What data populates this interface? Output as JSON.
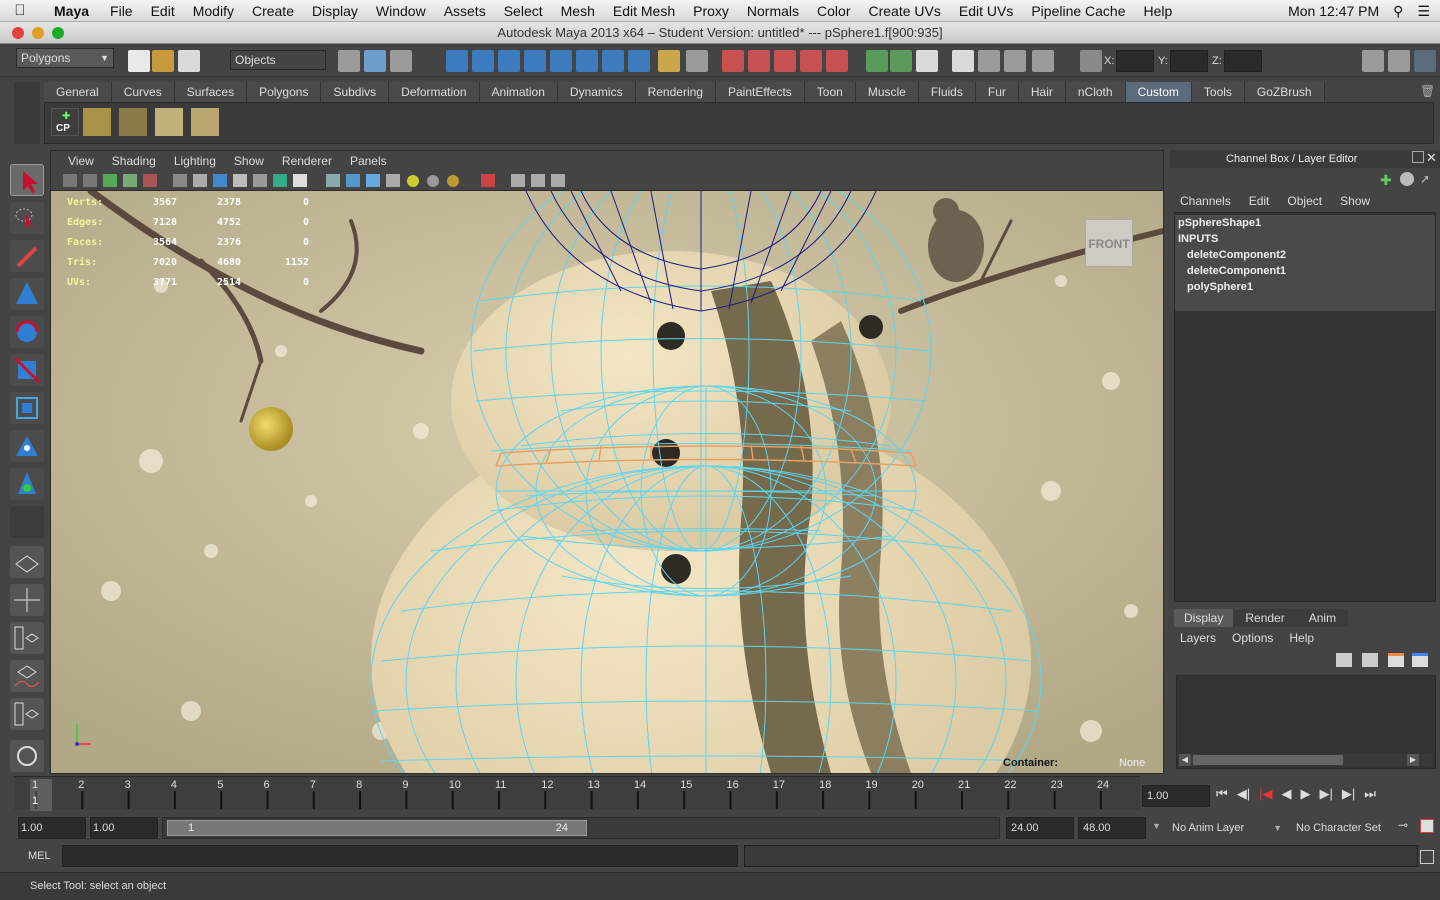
{
  "menubar": {
    "app": "Maya",
    "items": [
      "File",
      "Edit",
      "Modify",
      "Create",
      "Display",
      "Window",
      "Assets",
      "Select",
      "Mesh",
      "Edit Mesh",
      "Proxy",
      "Normals",
      "Color",
      "Create UVs",
      "Edit UVs",
      "Pipeline Cache",
      "Help"
    ],
    "clock": "Mon 12:47 PM"
  },
  "window": {
    "title": "Autodesk Maya 2013 x64 – Student Version: untitled*   ---   pSphere1.f[900:935]"
  },
  "statusline": {
    "menuset": "Polygons",
    "selection_mask": "Objects",
    "x_label": "X:",
    "y_label": "Y:",
    "z_label": "Z:"
  },
  "shelf": {
    "tabs": [
      "General",
      "Curves",
      "Surfaces",
      "Polygons",
      "Subdivs",
      "Deformation",
      "Animation",
      "Dynamics",
      "Rendering",
      "PaintEffects",
      "Toon",
      "Muscle",
      "Fluids",
      "Fur",
      "Hair",
      "nCloth",
      "Custom",
      "Tools",
      "GoZBrush"
    ],
    "active_tab": "Custom",
    "cp_label": "CP"
  },
  "viewport": {
    "menus": [
      "View",
      "Shading",
      "Lighting",
      "Show",
      "Renderer",
      "Panels"
    ],
    "hud": {
      "rows": [
        {
          "label": "Verts:",
          "a": "3567",
          "b": "2378",
          "c": "0"
        },
        {
          "label": "Edges:",
          "a": "7128",
          "b": "4752",
          "c": "0"
        },
        {
          "label": "Faces:",
          "a": "3564",
          "b": "2376",
          "c": "0"
        },
        {
          "label": "Tris:",
          "a": "7020",
          "b": "4680",
          "c": "1152"
        },
        {
          "label": "UVs:",
          "a": "3771",
          "b": "2514",
          "c": "0"
        }
      ],
      "view_cube": "FRONT",
      "container_label": "Container:",
      "container_value": "None"
    }
  },
  "channel_box": {
    "title": "Channel Box / Layer Editor",
    "menus": [
      "Channels",
      "Edit",
      "Object",
      "Show"
    ],
    "items": [
      "pSphereShape1",
      "INPUTS",
      "deleteComponent2",
      "deleteComponent1",
      "polySphere1"
    ]
  },
  "layer_editor": {
    "tabs": [
      "Display",
      "Render",
      "Anim"
    ],
    "active_tab": "Display",
    "menus": [
      "Layers",
      "Options",
      "Help"
    ]
  },
  "timeline": {
    "ticks": [
      "1",
      "2",
      "3",
      "4",
      "5",
      "6",
      "7",
      "8",
      "9",
      "10",
      "11",
      "12",
      "13",
      "14",
      "15",
      "16",
      "17",
      "18",
      "19",
      "20",
      "21",
      "22",
      "23",
      "24"
    ],
    "current_frame": "1",
    "current_time_field": "1.00"
  },
  "range": {
    "start_time": "1.00",
    "playback_start": "1.00",
    "range_start_label": "1",
    "range_end_label": "24",
    "playback_end": "24.00",
    "end_time": "48.00",
    "anim_layer": "No Anim Layer",
    "character_set": "No Character Set"
  },
  "command": {
    "mel_label": "MEL"
  },
  "help_line": {
    "text": "Select Tool: select an object"
  },
  "colors": {
    "wire": "#5fd4ef",
    "wire_dark": "#1a1a80",
    "selected_faces": "#e8a060",
    "accent": "#5b6b7c"
  }
}
